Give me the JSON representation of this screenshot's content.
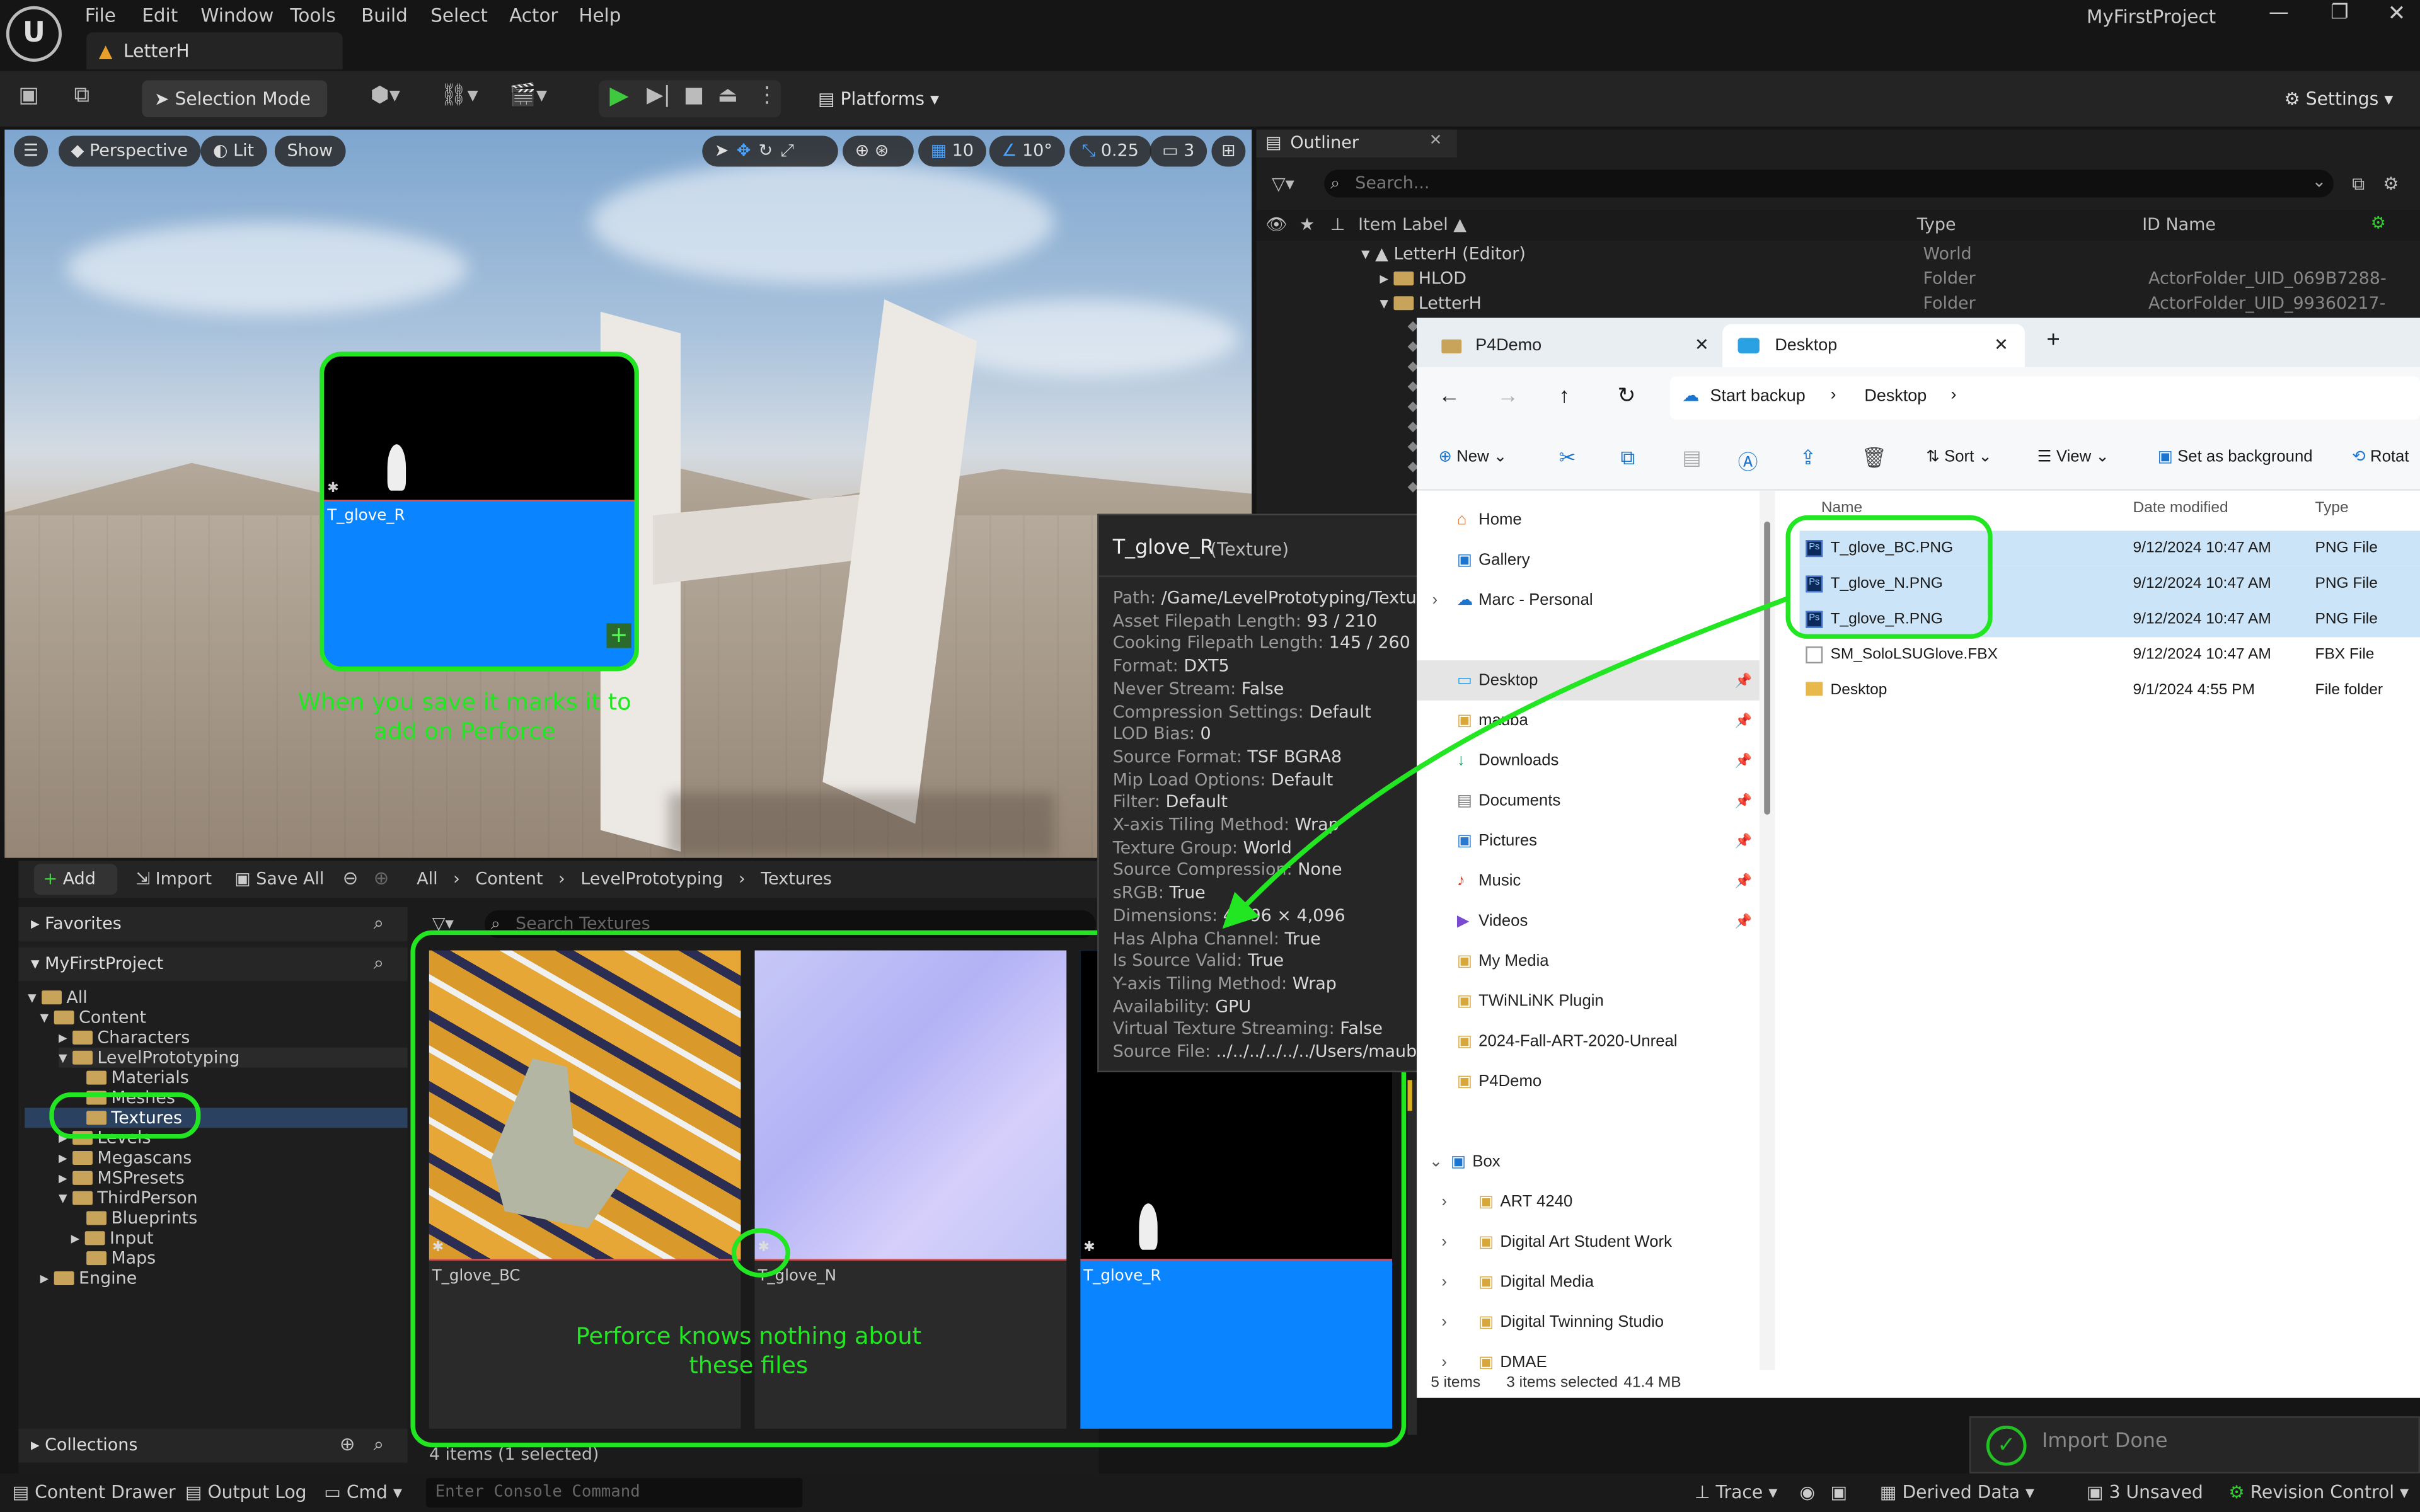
{
  "app": {
    "project_name": "MyFirstProject",
    "document_tab": "LetterH",
    "menu": [
      "File",
      "Edit",
      "Window",
      "Tools",
      "Build",
      "Select",
      "Actor",
      "Help"
    ]
  },
  "toolbar": {
    "selection_mode": "Selection Mode",
    "platforms": "Platforms",
    "settings": "Settings"
  },
  "viewport": {
    "perspective": "Perspective",
    "lit": "Lit",
    "show": "Show",
    "grid_snap": "10",
    "rot_snap": "10°",
    "scale_snap": "0.25",
    "camera_speed": "3",
    "drag_thumb_label": "T_glove_R",
    "annotation": "When you save it marks it to add on Perforce"
  },
  "outliner": {
    "tab": "Outliner",
    "search_placeholder": "Search...",
    "columns": [
      "Item Label ▲",
      "Type",
      "ID Name"
    ],
    "rows": [
      {
        "label": "LetterH (Editor)",
        "type": "World",
        "id": ""
      },
      {
        "label": "HLOD",
        "type": "Folder",
        "id": "ActorFolder_UID_069B7288-"
      },
      {
        "label": "LetterH",
        "type": "Folder",
        "id": "ActorFolder_UID_99360217-"
      }
    ]
  },
  "tooltip": {
    "title": "T_glove_R",
    "subtitle": "(Texture)",
    "lines": [
      {
        "k": "Path:",
        "v": "/Game/LevelPrototyping/Textures"
      },
      {
        "k": "Asset Filepath Length:",
        "v": "93 / 210"
      },
      {
        "k": "Cooking Filepath Length:",
        "v": "145 / 260"
      },
      {
        "k": "Format:",
        "v": "DXT5"
      },
      {
        "k": "Never Stream:",
        "v": "False"
      },
      {
        "k": "Compression Settings:",
        "v": "Default"
      },
      {
        "k": "LOD Bias:",
        "v": "0"
      },
      {
        "k": "Source Format:",
        "v": "TSF BGRA8"
      },
      {
        "k": "Mip Load Options:",
        "v": "Default"
      },
      {
        "k": "Filter:",
        "v": "Default"
      },
      {
        "k": "X-axis Tiling Method:",
        "v": "Wrap"
      },
      {
        "k": "Texture Group:",
        "v": "World"
      },
      {
        "k": "Source Compression:",
        "v": "None"
      },
      {
        "k": "sRGB:",
        "v": "True"
      },
      {
        "k": "Dimensions:",
        "v": "4,096 × 4,096"
      },
      {
        "k": "Has Alpha Channel:",
        "v": "True"
      },
      {
        "k": "Is Source Valid:",
        "v": "True"
      },
      {
        "k": "Y-axis Tiling Method:",
        "v": "Wrap"
      },
      {
        "k": "Availability:",
        "v": "GPU"
      },
      {
        "k": "Virtual Texture Streaming:",
        "v": "False"
      },
      {
        "k": "Source File:",
        "v": "../../../../../../Users/mauba/D"
      }
    ]
  },
  "explorer": {
    "tabs": [
      "P4Demo",
      "Desktop"
    ],
    "start_backup": "Start backup",
    "breadcrumb": "Desktop",
    "commands": [
      "New",
      "Sort",
      "View",
      "Set as background",
      "Rotat"
    ],
    "columns": [
      "Name",
      "Date modified",
      "Type"
    ],
    "sidebar": [
      "Home",
      "Gallery",
      "Marc - Personal",
      "Desktop",
      "mauba",
      "Downloads",
      "Documents",
      "Pictures",
      "Music",
      "Videos",
      "My Media",
      "TWiNLiNK Plugin",
      "2024-Fall-ART-2020-Unreal",
      "P4Demo",
      "Box",
      "ART 4240",
      "Digital Art Student Work",
      "Digital Media",
      "Digital Twinning Studio",
      "DMAE"
    ],
    "files": [
      {
        "name": "T_glove_BC.PNG",
        "date": "9/12/2024 10:47 AM",
        "type": "PNG File",
        "selected": true
      },
      {
        "name": "T_glove_N.PNG",
        "date": "9/12/2024 10:47 AM",
        "type": "PNG File",
        "selected": true
      },
      {
        "name": "T_glove_R.PNG",
        "date": "9/12/2024 10:47 AM",
        "type": "PNG File",
        "selected": true
      },
      {
        "name": "SM_SoloLSUGlove.FBX",
        "date": "9/12/2024 10:47 AM",
        "type": "FBX File",
        "selected": false
      },
      {
        "name": "Desktop",
        "date": "9/1/2024 4:55 PM",
        "type": "File folder",
        "selected": false
      }
    ],
    "status_items": "5 items",
    "status_selected": "3 items selected",
    "status_size": "41.4 MB"
  },
  "content_browser": {
    "add": "Add",
    "import": "Import",
    "save_all": "Save All",
    "path": [
      "All",
      "Content",
      "LevelPrototyping",
      "Textures"
    ],
    "search_placeholder": "Search Textures",
    "favorites": "Favorites",
    "project": "MyFirstProject",
    "tree": [
      "All",
      "Content",
      "Characters",
      "LevelPrototyping",
      "Materials",
      "Meshes",
      "Textures",
      "Levels",
      "Megascans",
      "MSPresets",
      "ThirdPerson",
      "Blueprints",
      "Input",
      "Maps",
      "Engine"
    ],
    "assets": [
      "T_glove_BC",
      "T_glove_N",
      "T_glove_R"
    ],
    "annotation": "Perforce knows nothing about these files",
    "count": "4 items (1 selected)",
    "collections": "Collections"
  },
  "notification": "Import Done",
  "statusbar": {
    "content_drawer": "Content Drawer",
    "output_log": "Output Log",
    "cmd": "Cmd",
    "console_placeholder": "Enter Console Command",
    "trace": "Trace",
    "derived_data": "Derived Data",
    "unsaved": "3 Unsaved",
    "revision_control": "Revision Control"
  },
  "colors": {
    "annotation_green": "#22e622",
    "selection_blue": "#cce4f7",
    "ue_blue": "#0a84ff"
  }
}
